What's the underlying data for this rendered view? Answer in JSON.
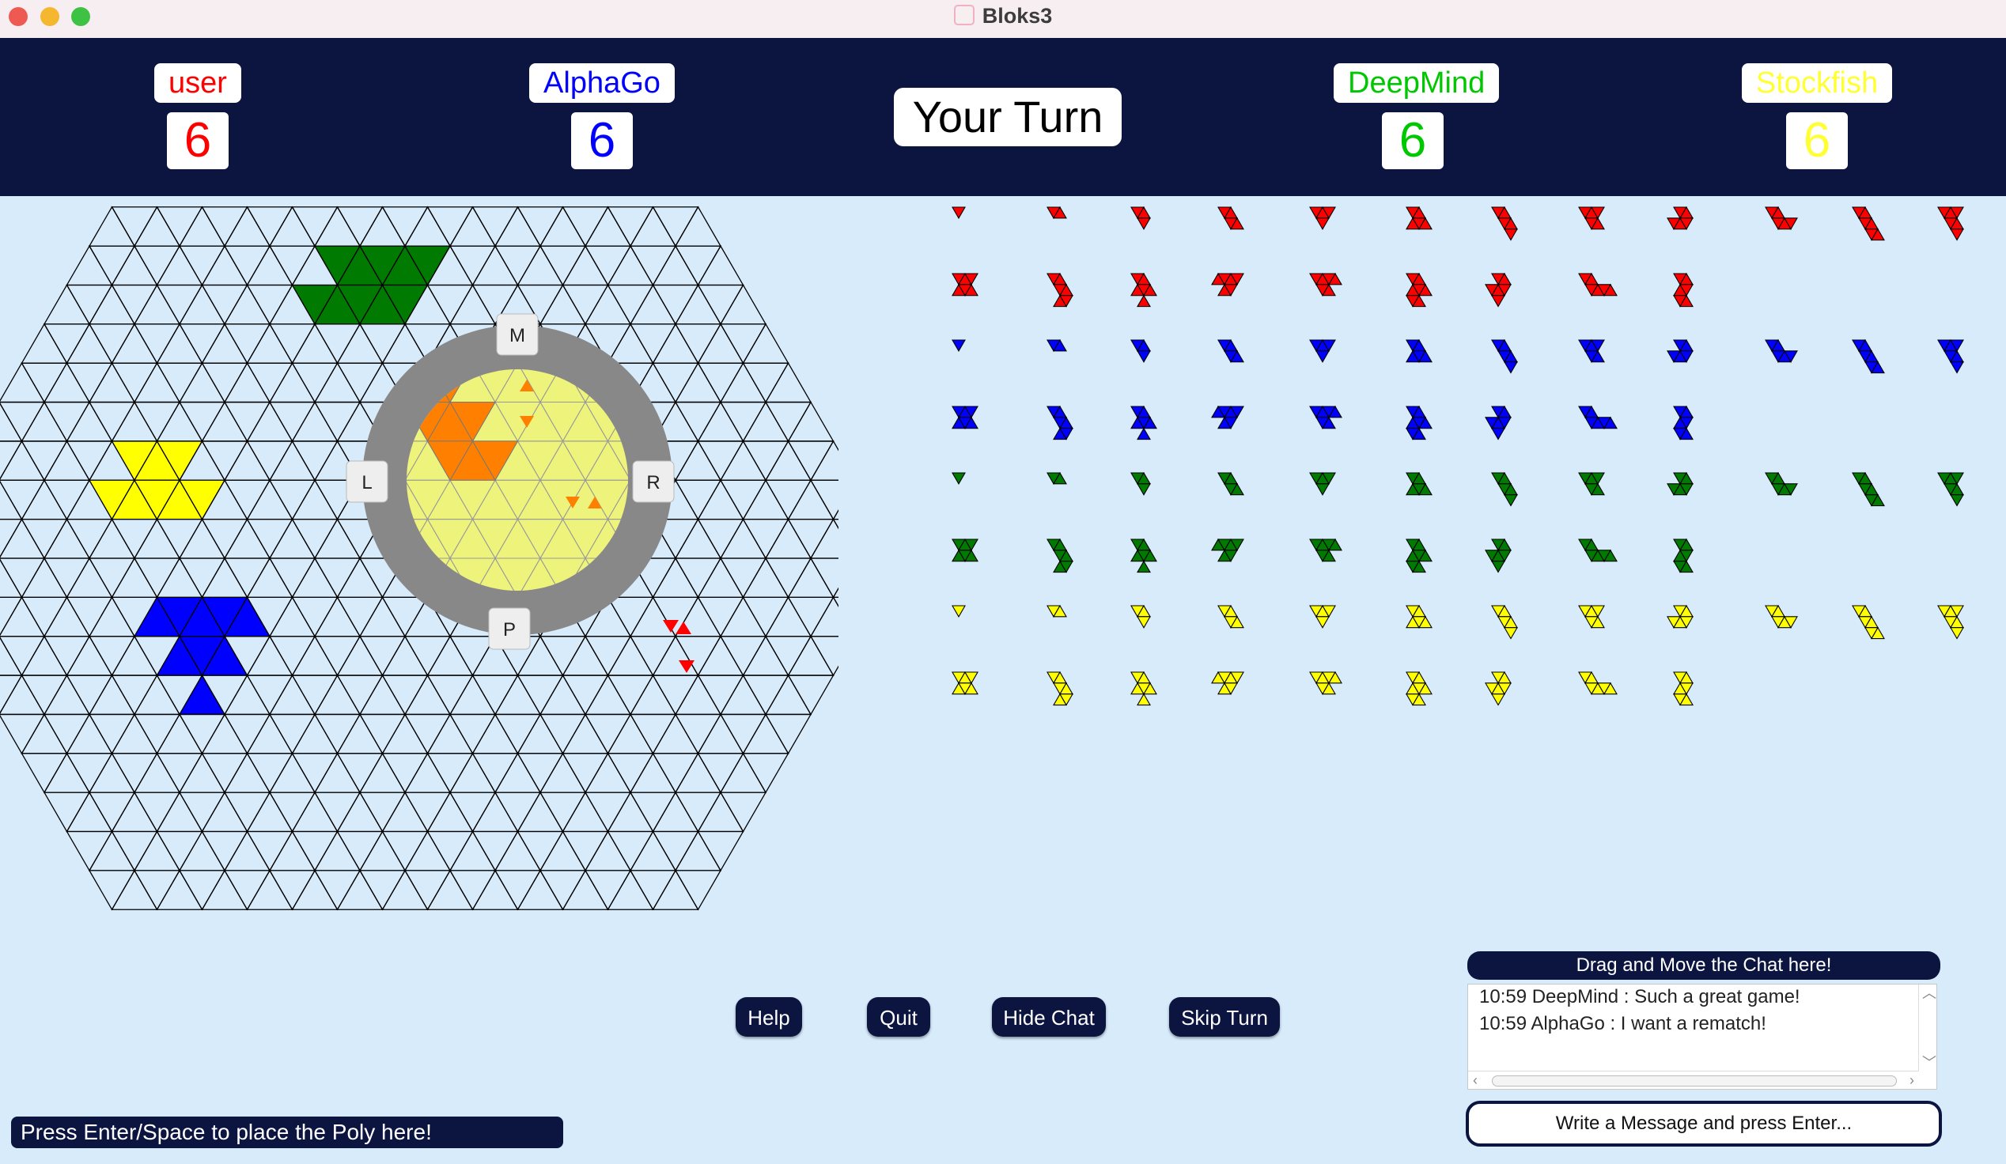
{
  "window": {
    "title": "Bloks3"
  },
  "players": [
    {
      "name": "user",
      "score": "6",
      "color": "#ff0000"
    },
    {
      "name": "AlphaGo",
      "score": "6",
      "color": "#0000ff"
    },
    {
      "name": "DeepMind",
      "score": "6",
      "color": "#00c800"
    },
    {
      "name": "Stockfish",
      "score": "6",
      "color": "#ffff33"
    }
  ],
  "turn_label": "Your Turn",
  "rotator": {
    "top": "M",
    "left": "L",
    "right": "R",
    "bottom": "P"
  },
  "buttons": {
    "help": "Help",
    "quit": "Quit",
    "hide_chat": "Hide Chat",
    "skip_turn": "Skip Turn"
  },
  "hint": "Press Enter/Space to place the Poly here!",
  "chat": {
    "handle": "Drag and Move the Chat here!",
    "messages": [
      "10:59 DeepMind : Such a great game!",
      "10:59 AlphaGo : I want a rematch!"
    ],
    "input_placeholder": "Write a Message and press Enter..."
  },
  "colors": {
    "background": "#d7ebfb",
    "header": "#0c1440",
    "red": "#ff0000",
    "blue": "#0000ff",
    "green": "#007a00",
    "yellow": "#ffff00",
    "orange": "#ff8000"
  }
}
